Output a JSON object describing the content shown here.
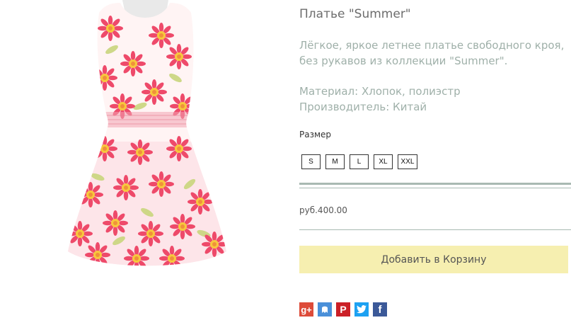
{
  "product": {
    "title": "Платье \"Summer\"",
    "description": "Лёгкое, яркое летнее платье свободного кроя, без рукавов из коллекции \"Summer\".",
    "material": "Материал: Хлопок, полиэстр",
    "manufacturer": "Производитель: Китай",
    "size_label": "Размер",
    "sizes": [
      "S",
      "M",
      "L",
      "XL",
      "XXL"
    ],
    "price": "руб.400.00",
    "add_to_cart": "Добавить в Корзину"
  },
  "share": {
    "gplus_glyph": "g+",
    "pinterest_glyph": "P",
    "facebook_glyph": "f"
  },
  "colors": {
    "accent_text": "#9fb0a9",
    "cart_button": "#f6efb0",
    "rule": "#a8b9b2",
    "gplus": "#dd4b39",
    "myworld": "#4a90d9",
    "pinterest": "#cb2027",
    "twitter": "#1da1f2",
    "facebook": "#3b5998"
  }
}
